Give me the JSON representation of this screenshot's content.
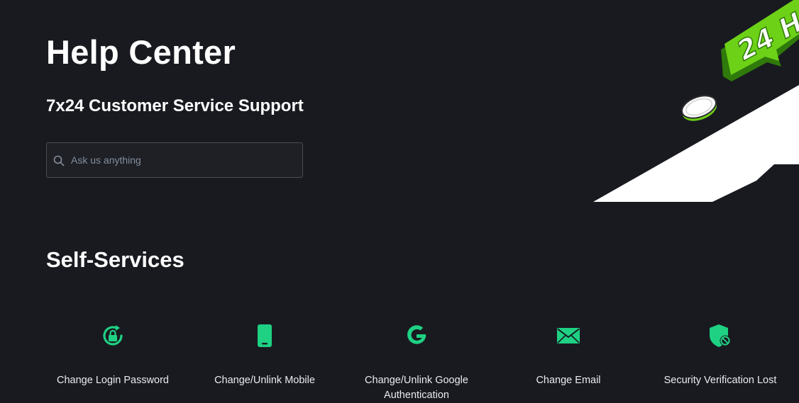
{
  "header": {
    "title": "Help Center",
    "subtitle": "7x24 Customer Service Support"
  },
  "search": {
    "placeholder": "Ask us anything",
    "icon": "search-icon"
  },
  "hero": {
    "badge_text": "24 H",
    "colors": {
      "accent_green": "#6dd117",
      "dark_green": "#2f7a0a",
      "white": "#ffffff"
    }
  },
  "self_services": {
    "title": "Self-Services",
    "items": [
      {
        "label": "Change Login Password",
        "icon": "lock-reset-icon"
      },
      {
        "label": "Change/Unlink Mobile",
        "icon": "mobile-phone-icon"
      },
      {
        "label": "Change/Unlink Google Authentication",
        "icon": "google-icon"
      },
      {
        "label": "Change Email",
        "icon": "envelope-icon"
      },
      {
        "label": "Security Verification Lost",
        "icon": "shield-block-icon"
      }
    ]
  },
  "colors": {
    "background": "#181a20",
    "icon_accent": "#1ed183",
    "input_border": "#474d57",
    "placeholder": "#848e9c",
    "text": "#eaecef"
  }
}
